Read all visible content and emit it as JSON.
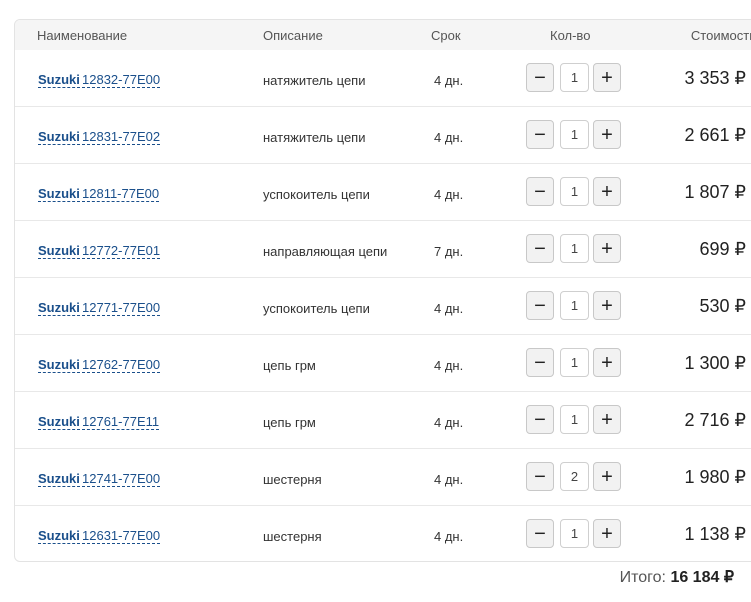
{
  "table": {
    "headers": {
      "name": "Наименование",
      "description": "Описание",
      "term": "Срок",
      "qty": "Кол-во",
      "cost": "Стоимость"
    },
    "rows": [
      {
        "brand": "Suzuki",
        "code": "12832-77E00",
        "description": "натяжитель цепи",
        "term": "4 дн.",
        "qty": "1",
        "price": "3 353 ₽"
      },
      {
        "brand": "Suzuki",
        "code": "12831-77E02",
        "description": "натяжитель цепи",
        "term": "4 дн.",
        "qty": "1",
        "price": "2 661 ₽"
      },
      {
        "brand": "Suzuki",
        "code": "12811-77E00",
        "description": "успокоитель цепи",
        "term": "4 дн.",
        "qty": "1",
        "price": "1 807 ₽"
      },
      {
        "brand": "Suzuki",
        "code": "12772-77E01",
        "description": "направляющая цепи",
        "term": "7 дн.",
        "qty": "1",
        "price": "699 ₽"
      },
      {
        "brand": "Suzuki",
        "code": "12771-77E00",
        "description": "успокоитель цепи",
        "term": "4 дн.",
        "qty": "1",
        "price": "530 ₽"
      },
      {
        "brand": "Suzuki",
        "code": "12762-77E00",
        "description": "цепь грм",
        "term": "4 дн.",
        "qty": "1",
        "price": "1 300 ₽"
      },
      {
        "brand": "Suzuki",
        "code": "12761-77E11",
        "description": "цепь грм",
        "term": "4 дн.",
        "qty": "1",
        "price": "2 716 ₽"
      },
      {
        "brand": "Suzuki",
        "code": "12741-77E00",
        "description": "шестерня",
        "term": "4 дн.",
        "qty": "2",
        "price": "1 980 ₽"
      },
      {
        "brand": "Suzuki",
        "code": "12631-77E00",
        "description": "шестерня",
        "term": "4 дн.",
        "qty": "1",
        "price": "1 138 ₽"
      }
    ]
  },
  "buttons": {
    "minus": "−",
    "plus": "+"
  },
  "total": {
    "label": "Итого:",
    "value": "16 184 ₽"
  },
  "icons": {
    "minus": "minus-icon",
    "plus": "plus-icon"
  },
  "colors": {
    "link": "#1a4f8b",
    "header_bg": "#f5f5f5",
    "border": "#e3e3e3"
  }
}
